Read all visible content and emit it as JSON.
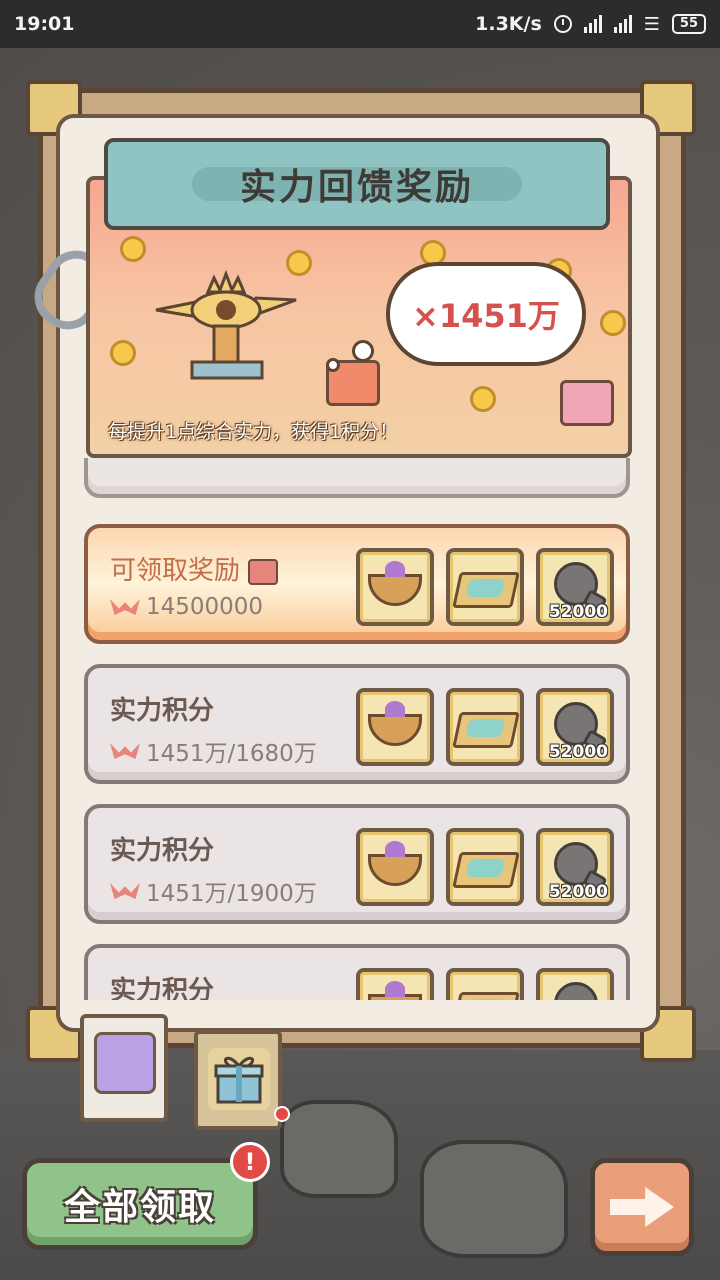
{
  "status_bar": {
    "time": "19:01",
    "network_speed": "1.3K/s",
    "battery": "55"
  },
  "panel": {
    "title": "实力回馈奖励",
    "banner": {
      "multiplier": "×1451万",
      "caption": "每提升1点综合实力，获得1积分！"
    }
  },
  "rewards": [
    {
      "title": "可领取奖励",
      "value": "14500000",
      "claimable": true,
      "items": [
        {
          "icon": "food-bowl-icon",
          "qty": ""
        },
        {
          "icon": "treasure-crate-icon",
          "qty": ""
        },
        {
          "icon": "shadow-blob-icon",
          "qty": "52000"
        }
      ]
    },
    {
      "title": "实力积分",
      "value": "1451万/1680万",
      "claimable": false,
      "items": [
        {
          "icon": "food-bowl-icon",
          "qty": ""
        },
        {
          "icon": "treasure-crate-icon",
          "qty": ""
        },
        {
          "icon": "shadow-blob-icon",
          "qty": "52000"
        }
      ]
    },
    {
      "title": "实力积分",
      "value": "1451万/1900万",
      "claimable": false,
      "items": [
        {
          "icon": "food-bowl-icon",
          "qty": ""
        },
        {
          "icon": "treasure-crate-icon",
          "qty": ""
        },
        {
          "icon": "shadow-blob-icon",
          "qty": "52000"
        }
      ]
    },
    {
      "title": "实力积分",
      "value": "",
      "claimable": false,
      "items": [
        {
          "icon": "food-bowl-icon",
          "qty": ""
        },
        {
          "icon": "treasure-crate-icon",
          "qty": ""
        },
        {
          "icon": "shadow-blob-icon",
          "qty": ""
        }
      ]
    }
  ],
  "tabs": [
    {
      "icon": "snail-icon",
      "selected": true
    },
    {
      "icon": "gift-box-icon",
      "selected": false,
      "has_dot": true
    }
  ],
  "buttons": {
    "claim_all": "全部领取",
    "alert": "!"
  },
  "colors": {
    "title_plate": "#8fc4c2",
    "claim_button": "#8fc38a",
    "next_button": "#e9a07a",
    "active_row": "#fbd7b1",
    "alert": "#e24b45"
  }
}
